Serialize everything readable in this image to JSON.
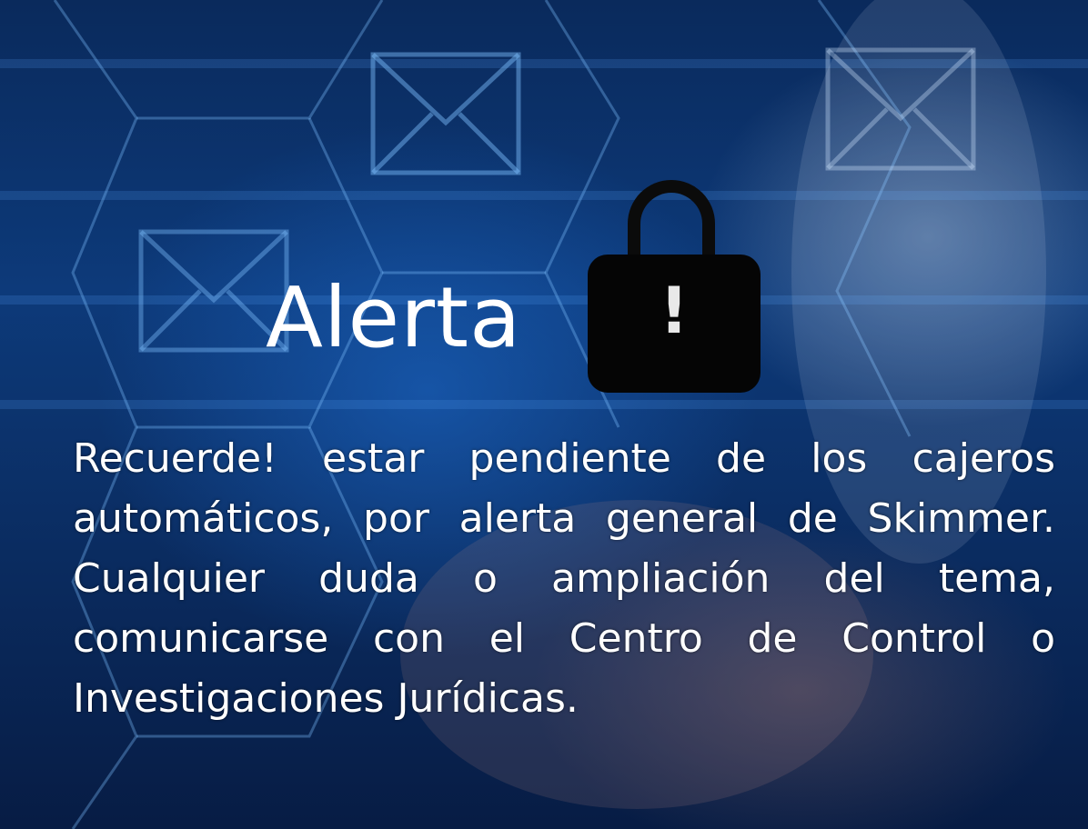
{
  "alert": {
    "title": "Alerta",
    "lock_symbol": "!",
    "message": "Recuerde! estar pendiente de los cajeros automáticos, por alerta general de Skimmer. Cualquier duda o ampliación del tema, comunicarse con el Centro de Control o Investigaciones Jurídicas."
  },
  "icons": {
    "lock": "lock-icon",
    "envelope": "envelope-icon"
  },
  "colors": {
    "background": "#0b2f66",
    "text": "#ffffff",
    "lock_body": "#050505",
    "lock_symbol": "#e9e9e9"
  }
}
